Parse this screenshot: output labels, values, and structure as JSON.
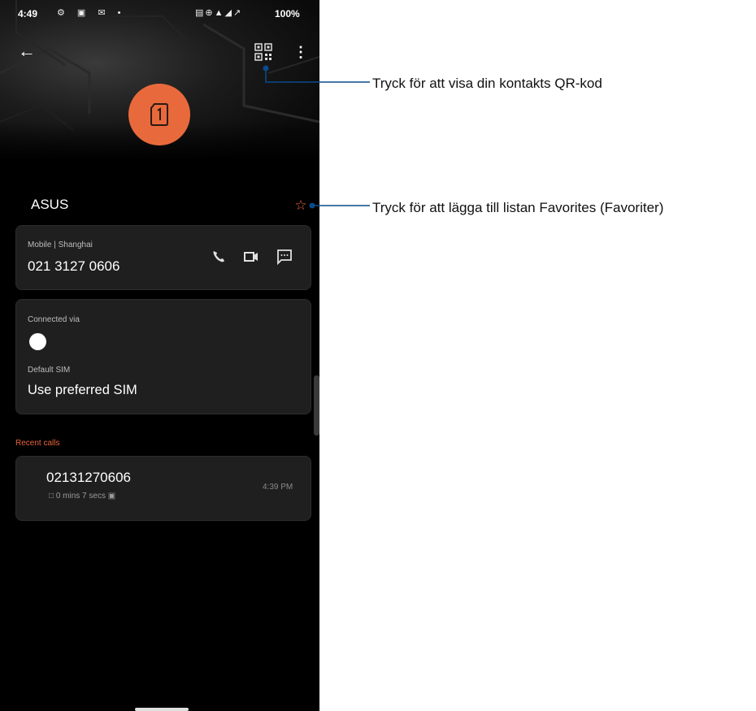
{
  "status_bar": {
    "time": "4:49",
    "left_icons": "⚙ ▣ ✉ •",
    "right_icons": "▤⊕▲◢↗",
    "battery": "100%"
  },
  "header": {
    "back_icon": "←",
    "qr_icon": "qr-code-icon",
    "more_icon": "⋮"
  },
  "contact": {
    "name": "ASUS",
    "favorite_icon": "☆"
  },
  "phone_card": {
    "label": "Mobile | Shanghai",
    "number": "021 3127 0606",
    "actions": [
      "call-icon",
      "video-call-icon",
      "message-icon"
    ]
  },
  "sim_card": {
    "connected_label": "Connected via",
    "default_label": "Default SIM",
    "default_value": "Use preferred SIM"
  },
  "recent_calls": {
    "title": "Recent calls",
    "items": [
      {
        "number": "02131270606",
        "duration": "0 mins 7 secs",
        "time": "4:39 PM"
      }
    ]
  },
  "callouts": {
    "qr": "Tryck för att visa din kontakts QR-kod",
    "favorites": "Tryck för att lägga till listan Favorites (Favoriter)"
  },
  "colors": {
    "accent": "#e8643a",
    "avatar": "#e86a3c",
    "callout_line": "#0a4a8c"
  }
}
